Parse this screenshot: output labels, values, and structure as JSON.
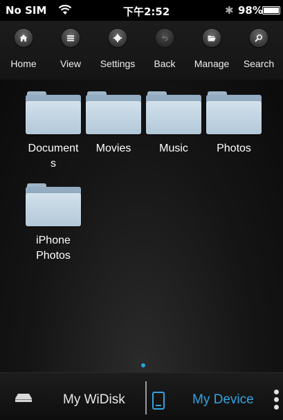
{
  "status_bar": {
    "carrier": "No SIM",
    "time": "下午2:52",
    "bluetooth": "✱",
    "battery": "98%",
    "battery_level": 0.98
  },
  "toolbar": {
    "items": [
      {
        "label": "Home",
        "icon": "home-icon"
      },
      {
        "label": "View",
        "icon": "list-icon"
      },
      {
        "label": "Settings",
        "icon": "gear-icon"
      },
      {
        "label": "Back",
        "icon": "back-arrow-icon"
      },
      {
        "label": "Manage",
        "icon": "folder-open-icon"
      },
      {
        "label": "Search",
        "icon": "search-icon"
      }
    ]
  },
  "folders": [
    {
      "name": "Document\ns"
    },
    {
      "name": "Movies"
    },
    {
      "name": "Music"
    },
    {
      "name": "Photos"
    },
    {
      "name": "iPhone\nPhotos"
    }
  ],
  "bottom_bar": {
    "widisk_label": "My WiDisk",
    "device_label": "My Device",
    "active_tab": "My Device",
    "accent_color": "#35a3e0"
  }
}
